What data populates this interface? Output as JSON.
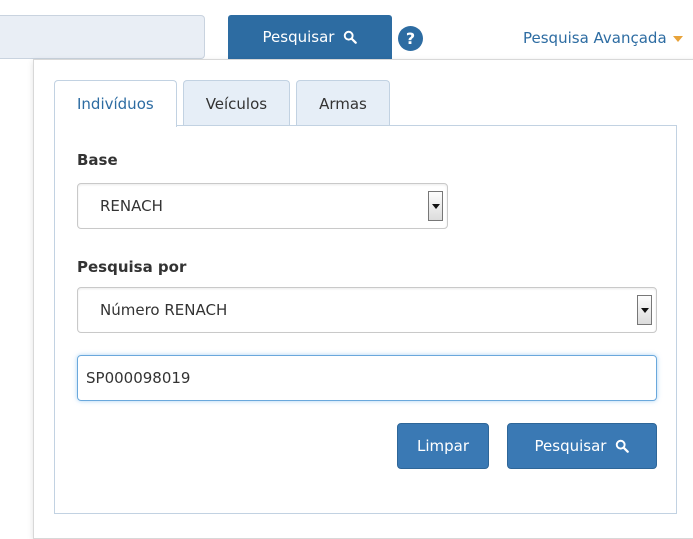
{
  "topbar": {
    "search_button_label": "Pesquisar",
    "help_glyph": "?",
    "advanced_search_label": "Pesquisa Avançada"
  },
  "tabs": [
    {
      "label": "Indivíduos",
      "active": true
    },
    {
      "label": "Veículos",
      "active": false
    },
    {
      "label": "Armas",
      "active": false
    }
  ],
  "form": {
    "base_label": "Base",
    "base_value": "RENACH",
    "search_by_label": "Pesquisa por",
    "search_by_value": "Número RENACH",
    "query_value": "SP000098019"
  },
  "actions": {
    "clear_label": "Limpar",
    "search_label": "Pesquisar"
  },
  "colors": {
    "primary": "#2d6ca2",
    "button": "#3a79b4",
    "accent_caret": "#e8a33a"
  },
  "icons": [
    "search-icon",
    "help-icon",
    "caret-down-icon",
    "select-arrow-icon"
  ]
}
